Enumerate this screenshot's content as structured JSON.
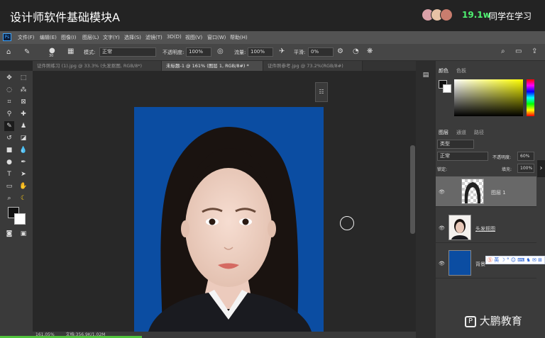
{
  "course": {
    "title": "设计师软件基础模块A",
    "viewer_count": "19.1w",
    "viewer_label": "同学在学习"
  },
  "menu": {
    "logo": "Ps",
    "items": [
      "文件(F)",
      "编辑(E)",
      "图像(I)",
      "图层(L)",
      "文字(Y)",
      "选择(S)",
      "滤镜(T)",
      "3D(D)",
      "视图(V)",
      "窗口(W)",
      "帮助(H)"
    ]
  },
  "options": {
    "brush_size": "30",
    "mode_label": "模式:",
    "mode_value": "正常",
    "opacity_label": "不透明度:",
    "opacity_value": "100%",
    "flow_label": "流量:",
    "flow_value": "100%",
    "smooth_label": "平滑:",
    "smooth_value": "0%"
  },
  "tabs": [
    "证件照练习 (1).jpg @ 33.3% (头发抠图, RGB/8*)",
    "未标题-1 @ 161% (图层 1, RGB/8#) *",
    "证件照参考.jpg @ 73.2%(RGB/8#)"
  ],
  "status": {
    "zoom": "161.05%",
    "doc_info": "文档:356.9K/1.02M"
  },
  "color_panel": {
    "tab_color": "颜色",
    "tab_swatches": "色板"
  },
  "layers_panel": {
    "tab_layers": "图层",
    "tab_channels": "通道",
    "tab_paths": "路径",
    "kind_label": "类型",
    "blend_mode": "正常",
    "opacity_label": "不透明度:",
    "opacity_value": "60%",
    "lock_label": "锁定:",
    "fill_label": "填充:",
    "fill_value": "100%",
    "layers": [
      {
        "name": "图层 1"
      },
      {
        "name": "头发抠图"
      },
      {
        "name": "背景"
      }
    ]
  },
  "ime": {
    "label": "英"
  },
  "watermark": {
    "text": "大鹏教育"
  },
  "colors": {
    "doc_blue": "#0b4da2",
    "accent_green": "#4ef070"
  }
}
